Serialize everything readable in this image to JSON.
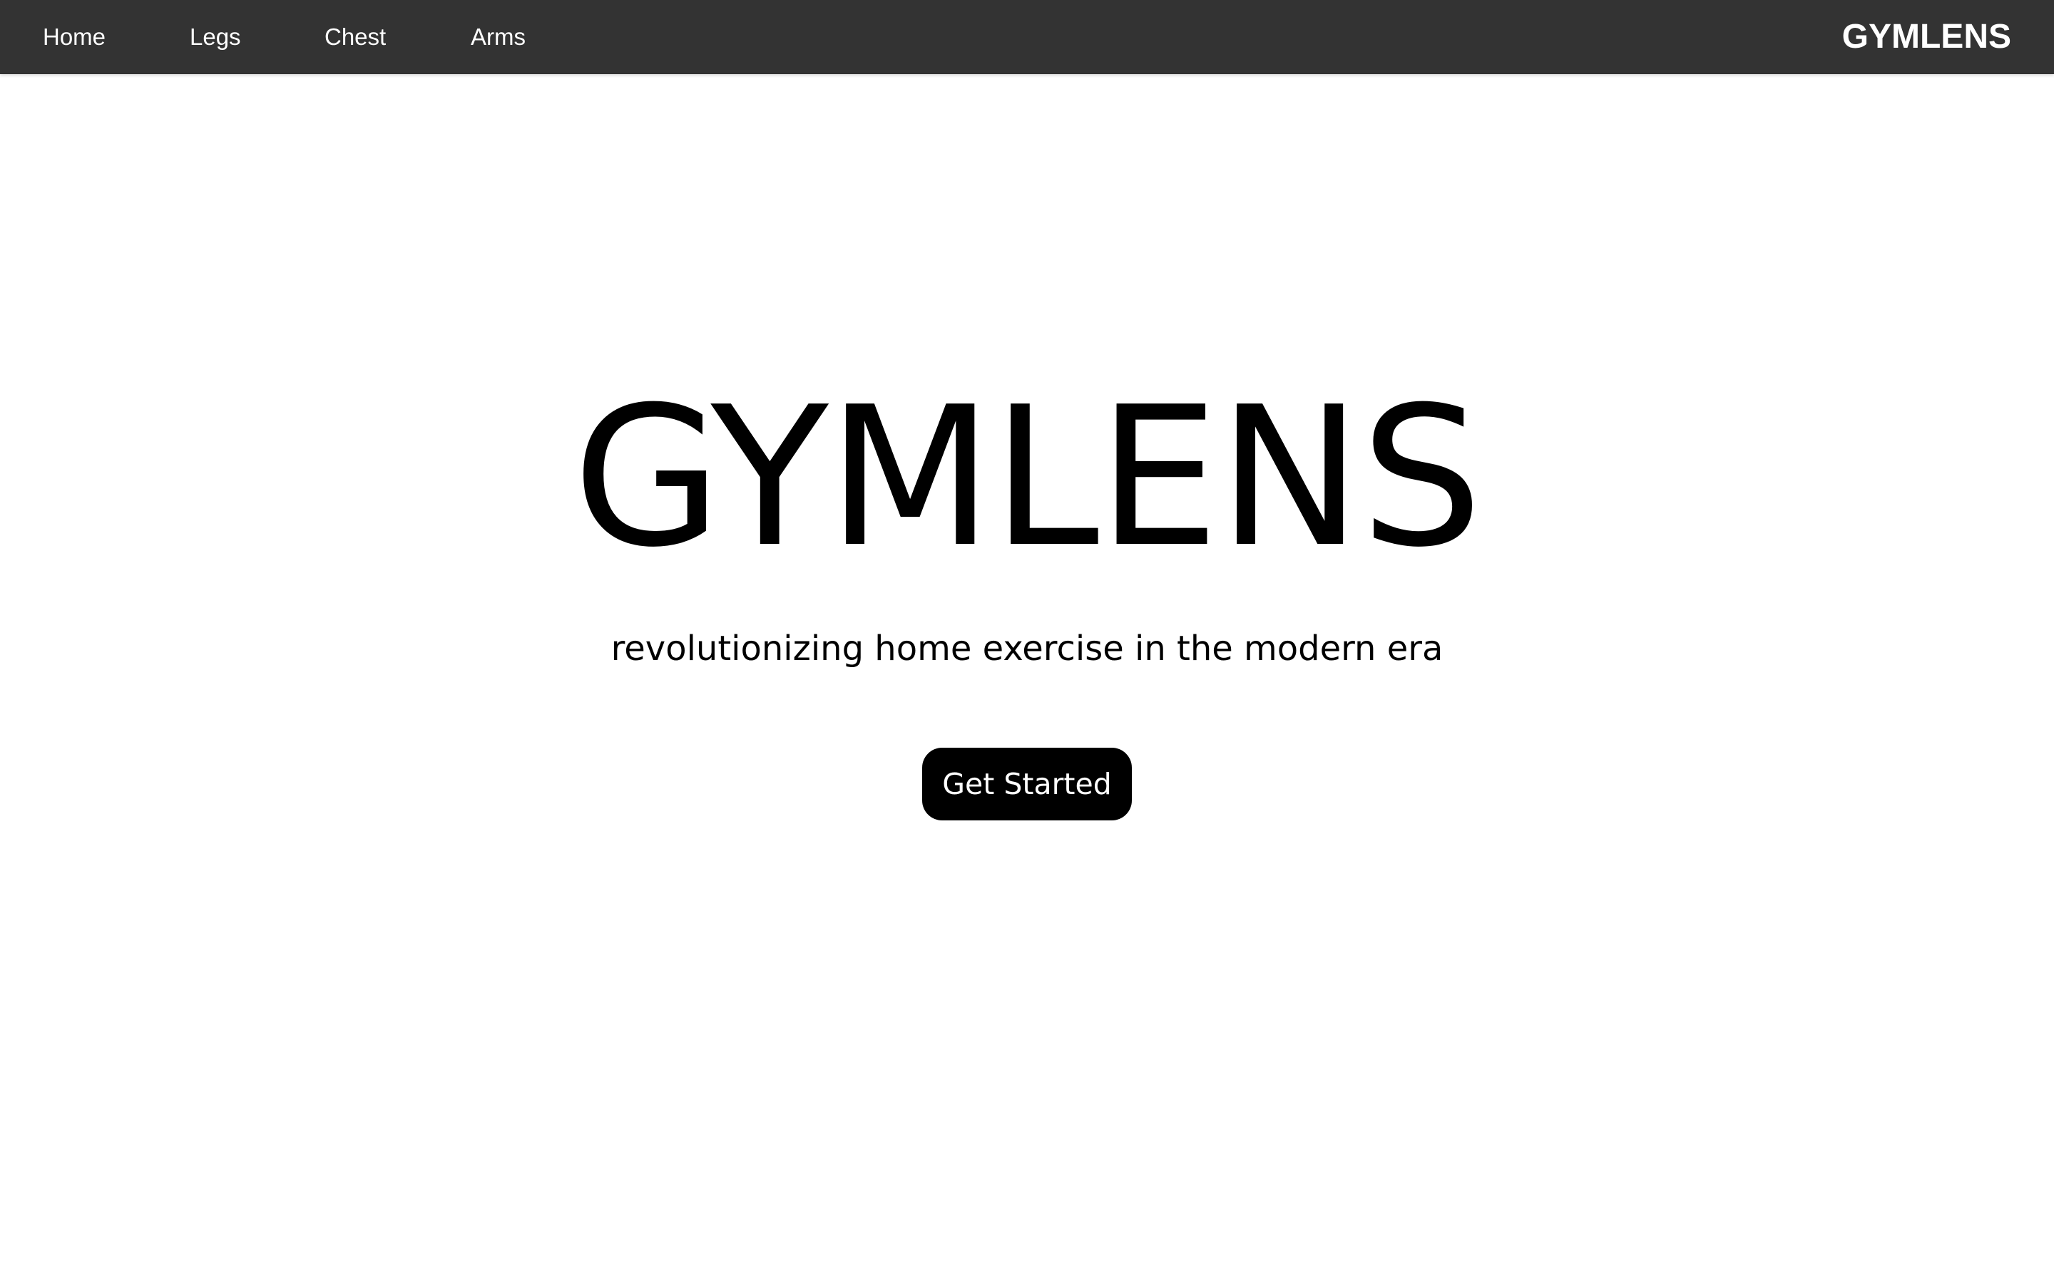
{
  "nav": {
    "links": [
      "Home",
      "Legs",
      "Chest",
      "Arms"
    ],
    "brand": "GYMLENS"
  },
  "hero": {
    "title": "GYMLENS",
    "subtitle": "revolutionizing home exercise in the modern era",
    "cta_label": "Get Started"
  },
  "colors": {
    "navbar_bg": "#333333",
    "nav_text": "#ffffff",
    "page_bg": "#ffffff",
    "text": "#000000",
    "button_bg": "#000000",
    "button_text": "#ffffff"
  }
}
